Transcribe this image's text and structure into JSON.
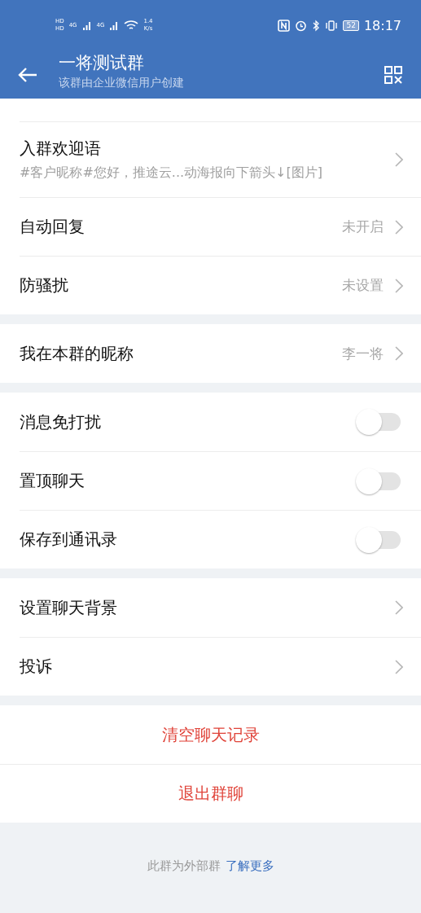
{
  "status_bar": {
    "hd": [
      "HD",
      "HD"
    ],
    "networks": [
      "4G",
      "4G"
    ],
    "speed": "1.4",
    "speed_unit": "K/s",
    "battery": "52",
    "time": "18:17"
  },
  "header": {
    "title": "一将测试群",
    "subtitle": "该群由企业微信用户创建"
  },
  "sections": [
    [
      {
        "kind": "link",
        "title": "入群欢迎语",
        "subtitle": "#客户昵称#您好，推途云...动海报向下箭头↓[图片]"
      },
      {
        "kind": "link",
        "title": "自动回复",
        "value": "未开启"
      },
      {
        "kind": "link",
        "title": "防骚扰",
        "value": "未设置"
      }
    ],
    [
      {
        "kind": "link",
        "title": "我在本群的昵称",
        "value": "李一将"
      }
    ],
    [
      {
        "kind": "toggle",
        "title": "消息免打扰",
        "on": false
      },
      {
        "kind": "toggle",
        "title": "置顶聊天",
        "on": false
      },
      {
        "kind": "toggle",
        "title": "保存到通讯录",
        "on": false
      }
    ],
    [
      {
        "kind": "link",
        "title": "设置聊天背景"
      },
      {
        "kind": "link",
        "title": "投诉"
      }
    ],
    [
      {
        "kind": "action",
        "title": "清空聊天记录"
      },
      {
        "kind": "action",
        "title": "退出群聊"
      }
    ]
  ],
  "footer": {
    "text": "此群为外部群",
    "link": "了解更多"
  }
}
